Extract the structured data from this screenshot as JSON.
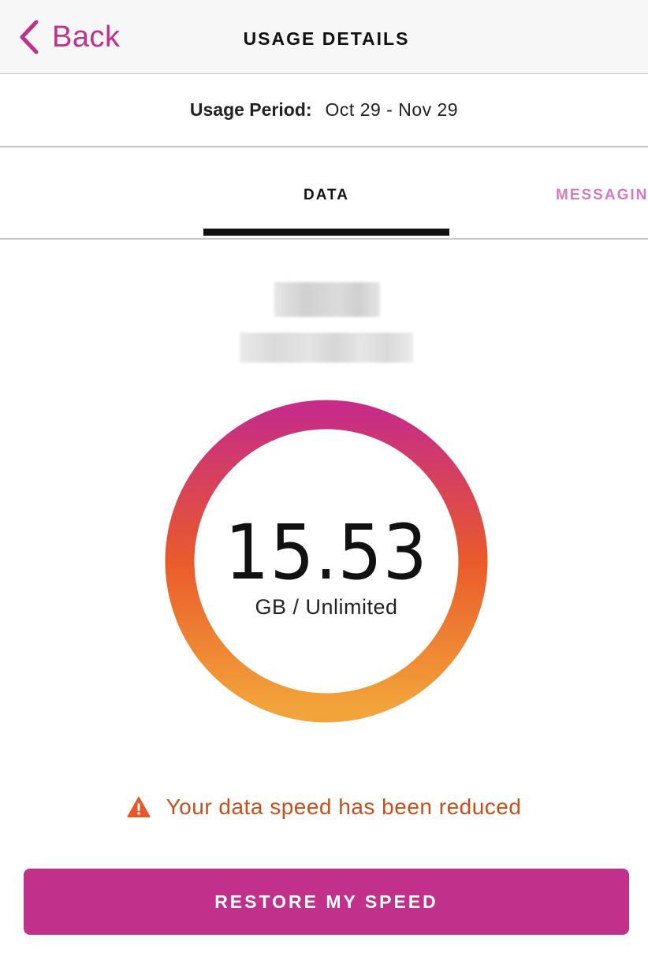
{
  "header": {
    "back_label": "Back",
    "title": "USAGE DETAILS"
  },
  "usage_period": {
    "label": "Usage Period:",
    "value": "Oct 29 - Nov 29"
  },
  "tabs": [
    {
      "label": "DATA",
      "selected": true
    },
    {
      "label": "MESSAGIN",
      "selected": false
    }
  ],
  "usage": {
    "amount": "15.53",
    "unit": "GB / Unlimited",
    "ring_gradient": [
      "#c72d86",
      "#e95a2b",
      "#f2a43a"
    ]
  },
  "alert": {
    "icon": "warning-icon",
    "text": "Your data speed has been reduced",
    "color": "#c4501d"
  },
  "action": {
    "label": "RESTORE MY SPEED",
    "color": "#c1308b"
  },
  "colors": {
    "accent": "#c1308b",
    "tab_inactive": "#d47bbd"
  }
}
